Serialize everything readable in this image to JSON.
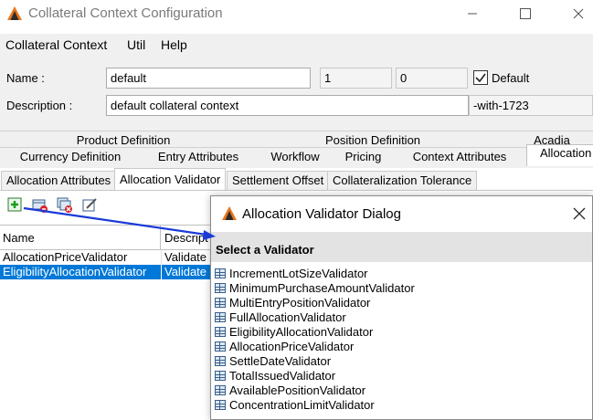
{
  "window": {
    "title": "Collateral Context Configuration"
  },
  "menu": [
    "Collateral Context",
    "Util",
    "Help"
  ],
  "form": {
    "name_label": "Name :",
    "name_value": "default",
    "field_a": "1",
    "field_b": "0",
    "default_label": "Default",
    "default_checked": true,
    "description_label": "Description :",
    "description_value": "default collateral context",
    "suffix_value": "-with-1723"
  },
  "tabs_row1": [
    "Product Definition",
    "Position Definition",
    "Acadia"
  ],
  "tabs_row2": [
    "Currency Definition",
    "Entry Attributes",
    "Workflow",
    "Pricing",
    "Context Attributes",
    "Allocation"
  ],
  "subtabs": [
    "Allocation Attributes",
    "Allocation Validator",
    "Settlement Offset",
    "Collateralization Tolerance"
  ],
  "table": {
    "headers": [
      "Name",
      "Descript"
    ],
    "rows": [
      [
        "AllocationPriceValidator",
        "Validate"
      ],
      [
        "EligibilityAllocationValidator",
        "Validate"
      ]
    ]
  },
  "dialog": {
    "title": "Allocation Validator Dialog",
    "header": "Select a Validator",
    "validators": [
      "IncrementLotSizeValidator",
      "MinimumPurchaseAmountValidator",
      "MultiEntryPositionValidator",
      "FullAllocationValidator",
      "EligibilityAllocationValidator",
      "AllocationPriceValidator",
      "SettleDateValidator",
      "TotalIssuedValidator",
      "AvailablePositionValidator",
      "ConcentrationLimitValidator"
    ]
  },
  "colors": {
    "selection": "#0078d7",
    "arrow": "#1a3ad8",
    "logo_orange": "#e8751a"
  }
}
